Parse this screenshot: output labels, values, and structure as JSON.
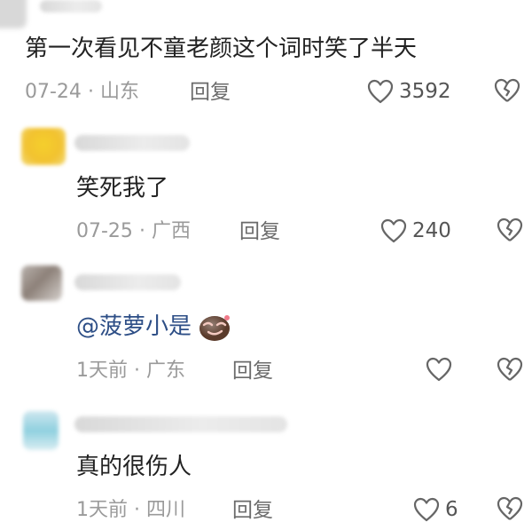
{
  "comments": [
    {
      "text": "第一次看见不童老颜这个词时笑了半天",
      "date": "07-24",
      "location": "山东",
      "reply_label": "回复",
      "likes": "3592"
    },
    {
      "text": "笑死我了",
      "date": "07-25",
      "location": "广西",
      "reply_label": "回复",
      "likes": "240"
    },
    {
      "mention": "@菠萝小是",
      "emoji": "smirk-face-emoji",
      "date": "1天前",
      "location": "广东",
      "reply_label": "回复",
      "likes": ""
    },
    {
      "text": "真的很伤人",
      "date": "1天前",
      "location": "四川",
      "reply_label": "回复",
      "likes": "6"
    }
  ],
  "icons": {
    "like": "heart-outline-icon",
    "dislike": "broken-heart-icon"
  },
  "colors": {
    "text": "#222222",
    "meta": "#9a9a9a",
    "mention": "#2d4e86",
    "icon": "#666666"
  }
}
